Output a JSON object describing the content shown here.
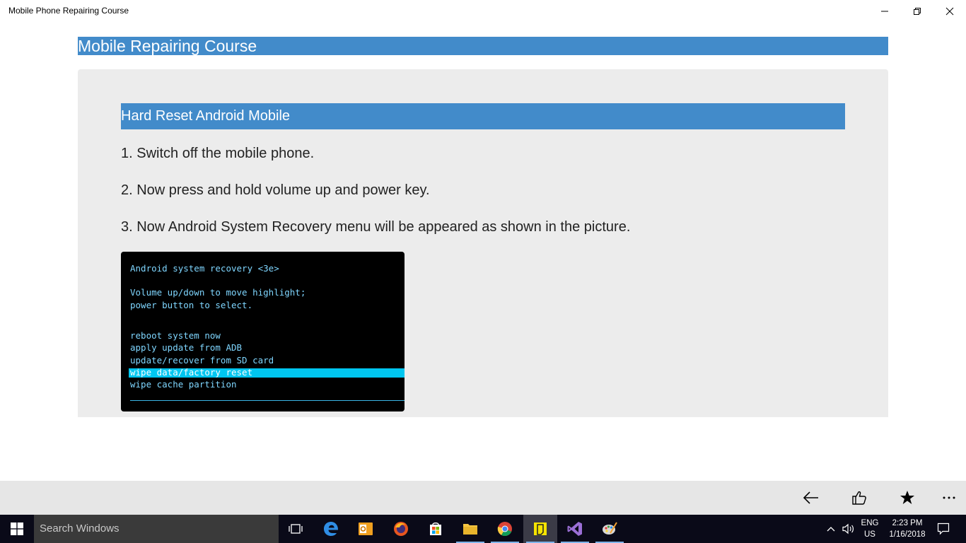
{
  "window": {
    "title": "Mobile Phone Repairing Course"
  },
  "page": {
    "header": "Mobile Repairing Course",
    "section_title": "Hard Reset Android Mobile",
    "steps": [
      "1. Switch off the mobile phone.",
      "2. Now press and hold volume up and power key.",
      "3. Now Android System Recovery menu will be appeared as shown in the picture."
    ]
  },
  "recovery_screen": {
    "title": "Android system recovery <3e>",
    "instructions": [
      "Volume up/down to move highlight;",
      "power button to select."
    ],
    "menu": [
      "reboot system now",
      "apply update from ADB",
      "update/recover from SD card",
      "wipe data/factory reset",
      "wipe cache partition"
    ],
    "selected_index": 3,
    "text_color": "#7fd6ff",
    "highlight_color": "#00c6f0"
  },
  "appbar": {
    "icons": [
      "back-arrow-icon",
      "thumbs-up-icon",
      "star-icon",
      "more-icon"
    ]
  },
  "taskbar": {
    "search_placeholder": "Search Windows",
    "language": "ENG",
    "region": "US",
    "time": "2:23 PM",
    "date": "1/16/2018",
    "pinned_icons": [
      "task-view-icon",
      "edge-icon",
      "outlook-icon",
      "firefox-icon",
      "store-icon",
      "file-explorer-icon",
      "chrome-icon",
      "sticky-notes-icon",
      "visual-studio-icon",
      "paint-icon"
    ]
  },
  "colors": {
    "accent": "#428bca",
    "panel": "#ececec",
    "taskbar": "#0a0a18"
  }
}
